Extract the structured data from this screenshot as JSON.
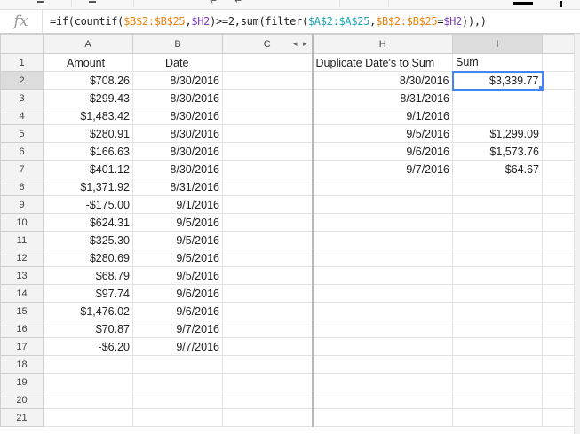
{
  "formula_bar": {
    "fx_label": "fx",
    "formula_parts": [
      {
        "text": "=if(countif(",
        "color": "default"
      },
      {
        "text": "$B$2:$B$25",
        "color": "orange"
      },
      {
        "text": ",",
        "color": "default"
      },
      {
        "text": "$H2",
        "color": "purple"
      },
      {
        "text": ")>=2,sum(filter(",
        "color": "default"
      },
      {
        "text": "$A$2:$A$25",
        "color": "teal"
      },
      {
        "text": ",",
        "color": "default"
      },
      {
        "text": "$B$2:$B$25",
        "color": "orange"
      },
      {
        "text": "=",
        "color": "default"
      },
      {
        "text": "$H2",
        "color": "purple"
      },
      {
        "text": ")),)",
        "color": "default"
      }
    ]
  },
  "colors": {
    "selection": "#4285f4",
    "formula_orange": "#e8820c",
    "formula_teal": "#1fa3b5",
    "formula_purple": "#7e3fc2"
  },
  "columns": [
    "A",
    "B",
    "C",
    "H",
    "I"
  ],
  "hidden_columns_indicator": "◂ ▸",
  "rows": [
    {
      "n": "1",
      "A": "Amount",
      "B": "Date",
      "H": "Duplicate Date's to Sum",
      "I": "Sum"
    },
    {
      "n": "2",
      "A": "$708.26",
      "B": "8/30/2016",
      "H": "8/30/2016",
      "I": "$3,339.77"
    },
    {
      "n": "3",
      "A": "$299.43",
      "B": "8/30/2016",
      "H": "8/31/2016",
      "I": ""
    },
    {
      "n": "4",
      "A": "$1,483.42",
      "B": "8/30/2016",
      "H": "9/1/2016",
      "I": ""
    },
    {
      "n": "5",
      "A": "$280.91",
      "B": "8/30/2016",
      "H": "9/5/2016",
      "I": "$1,299.09"
    },
    {
      "n": "6",
      "A": "$166.63",
      "B": "8/30/2016",
      "H": "9/6/2016",
      "I": "$1,573.76"
    },
    {
      "n": "7",
      "A": "$401.12",
      "B": "8/30/2016",
      "H": "9/7/2016",
      "I": "$64.67"
    },
    {
      "n": "8",
      "A": "$1,371.92",
      "B": "8/31/2016",
      "H": "",
      "I": ""
    },
    {
      "n": "9",
      "A": "-$175.00",
      "B": "9/1/2016",
      "H": "",
      "I": ""
    },
    {
      "n": "10",
      "A": "$624.31",
      "B": "9/5/2016",
      "H": "",
      "I": ""
    },
    {
      "n": "11",
      "A": "$325.30",
      "B": "9/5/2016",
      "H": "",
      "I": ""
    },
    {
      "n": "12",
      "A": "$280.69",
      "B": "9/5/2016",
      "H": "",
      "I": ""
    },
    {
      "n": "13",
      "A": "$68.79",
      "B": "9/5/2016",
      "H": "",
      "I": ""
    },
    {
      "n": "14",
      "A": "$97.74",
      "B": "9/6/2016",
      "H": "",
      "I": ""
    },
    {
      "n": "15",
      "A": "$1,476.02",
      "B": "9/6/2016",
      "H": "",
      "I": ""
    },
    {
      "n": "16",
      "A": "$70.87",
      "B": "9/7/2016",
      "H": "",
      "I": ""
    },
    {
      "n": "17",
      "A": "-$6.20",
      "B": "9/7/2016",
      "H": "",
      "I": ""
    },
    {
      "n": "18",
      "A": "",
      "B": "",
      "H": "",
      "I": ""
    },
    {
      "n": "19",
      "A": "",
      "B": "",
      "H": "",
      "I": ""
    },
    {
      "n": "20",
      "A": "",
      "B": "",
      "H": "",
      "I": ""
    },
    {
      "n": "21",
      "A": "",
      "B": "",
      "H": "",
      "I": ""
    }
  ],
  "selected_cell": {
    "row": "2",
    "col": "I"
  }
}
